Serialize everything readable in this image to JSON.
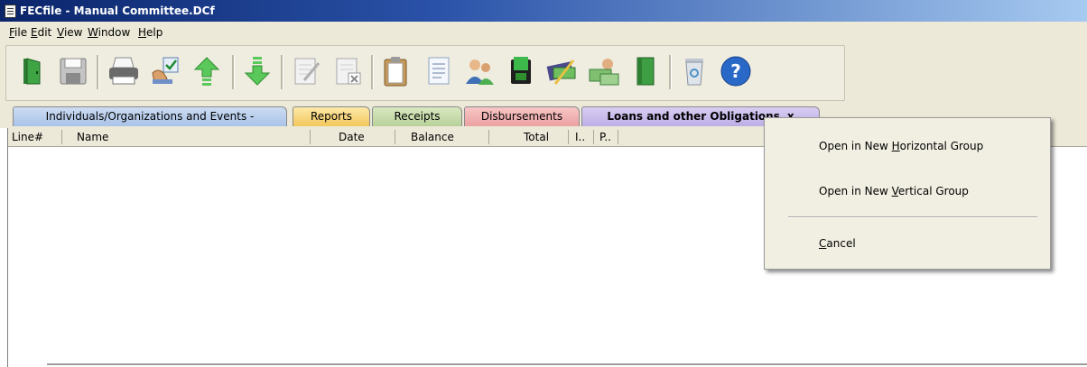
{
  "window": {
    "title": "FECfile - Manual Committee.DCf"
  },
  "menu": [
    {
      "pre": "",
      "key": "F",
      "post": "ile"
    },
    {
      "pre": "",
      "key": "E",
      "post": "dit"
    },
    {
      "pre": "",
      "key": "V",
      "post": "iew"
    },
    {
      "pre": "",
      "key": "W",
      "post": "indow"
    },
    {
      "pre": "",
      "key": "H",
      "post": "elp"
    }
  ],
  "toolbar_icons": [
    "exit-door-icon",
    "save-icon",
    "print-icon",
    "validate-icon",
    "upload-icon",
    "download-icon",
    "edit-icon",
    "delete-icon",
    "clipboard-icon",
    "document-icon",
    "contacts-icon",
    "receipt-icon",
    "disbursement-icon",
    "loan-icon",
    "report-book-icon",
    "recycle-bin-icon",
    "help-icon"
  ],
  "tabs": [
    {
      "label": "Individuals/Organizations and Events -"
    },
    {
      "label": "Reports"
    },
    {
      "label": "Receipts"
    },
    {
      "label": "Disbursements"
    },
    {
      "label": "Loans and other Obligations",
      "close": "x"
    }
  ],
  "columns": [
    "Line#",
    "Name",
    "Date",
    "Balance",
    "Total",
    "I..",
    "P.."
  ],
  "context_menu": [
    {
      "pre": "Open in New ",
      "key": "H",
      "post": "orizontal Group"
    },
    {
      "pre": "Open in New ",
      "key": "V",
      "post": "ertical Group"
    },
    {
      "pre": "",
      "key": "C",
      "post": "ancel"
    }
  ],
  "colors": {
    "title_bar": "#0a246a",
    "chrome": "#ece9d8",
    "tab_individuals": "#aac3e8",
    "tab_reports": "#f3c75c",
    "tab_receipts": "#b8d19a",
    "tab_disbursements": "#eba1a1",
    "tab_loans": "#bdaee6"
  }
}
